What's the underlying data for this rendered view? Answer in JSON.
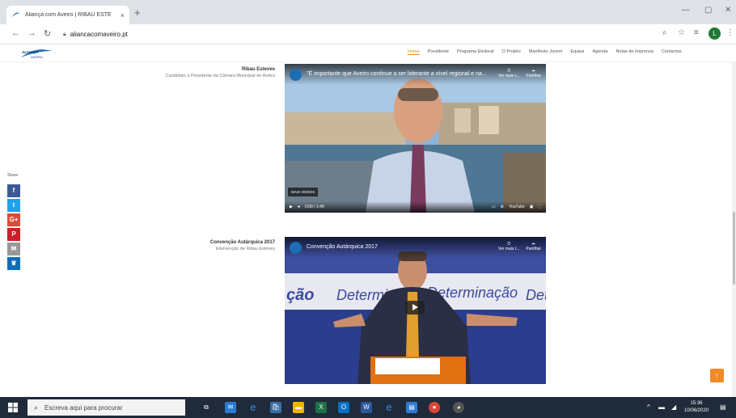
{
  "browser": {
    "tab_title": "Aliança com Aveiro | RIBAU ESTE",
    "tab_close": "×",
    "new_tab": "+",
    "url": "aliancacomaveiro.pt",
    "minimize": "—",
    "maximize": "▢",
    "close": "✕",
    "profile_initial": "L"
  },
  "site": {
    "logo_text": "ALIANÇA com AVEIRO",
    "nav": [
      "Home",
      "Presidente",
      "Programa Eleitoral",
      "O Projeto",
      "Manifesto Jovem",
      "Equipa",
      "Agenda",
      "Notas de Imprensa",
      "Contactos"
    ],
    "active_nav": "Home"
  },
  "videos": [
    {
      "caption_title": "Ribau Esteves",
      "caption_text": "Candidato a Presidente da Câmara Municipal de Aveiro",
      "title": "\"É importante que Aveiro continue a ser liderante a nível regional e na...",
      "watch_later": "Ver mais t...",
      "share": "Partilhar",
      "more_videos": "MAIS VÍDEOS",
      "time": "0:00 / 1:49",
      "youtube": "YouTube"
    },
    {
      "caption_title": "Convenção Autárquica 2017",
      "caption_text": "Intervenção de Ribau Esteves",
      "title": "Convenção Autárquica 2017",
      "watch_later": "Ver mais t...",
      "share": "Partilhar",
      "banner_left": "ção",
      "banner_mid": "Determin",
      "banner_right": "Determinação",
      "banner_far": "Dete"
    }
  ],
  "share": {
    "label": "Share",
    "buttons": [
      {
        "name": "facebook",
        "glyph": "f",
        "color": "#3b5998"
      },
      {
        "name": "twitter",
        "glyph": "t",
        "color": "#1da1f2"
      },
      {
        "name": "google-plus",
        "glyph": "G+",
        "color": "#dd4b39"
      },
      {
        "name": "pinterest",
        "glyph": "P",
        "color": "#cb2027"
      },
      {
        "name": "email",
        "glyph": "✉",
        "color": "#999999"
      },
      {
        "name": "crown",
        "glyph": "♛",
        "color": "#0e6eb8"
      }
    ]
  },
  "to_top": "↑",
  "taskbar": {
    "search_placeholder": "Escreva aqui para procurar",
    "time": "15:36",
    "date": "10/06/2020"
  }
}
